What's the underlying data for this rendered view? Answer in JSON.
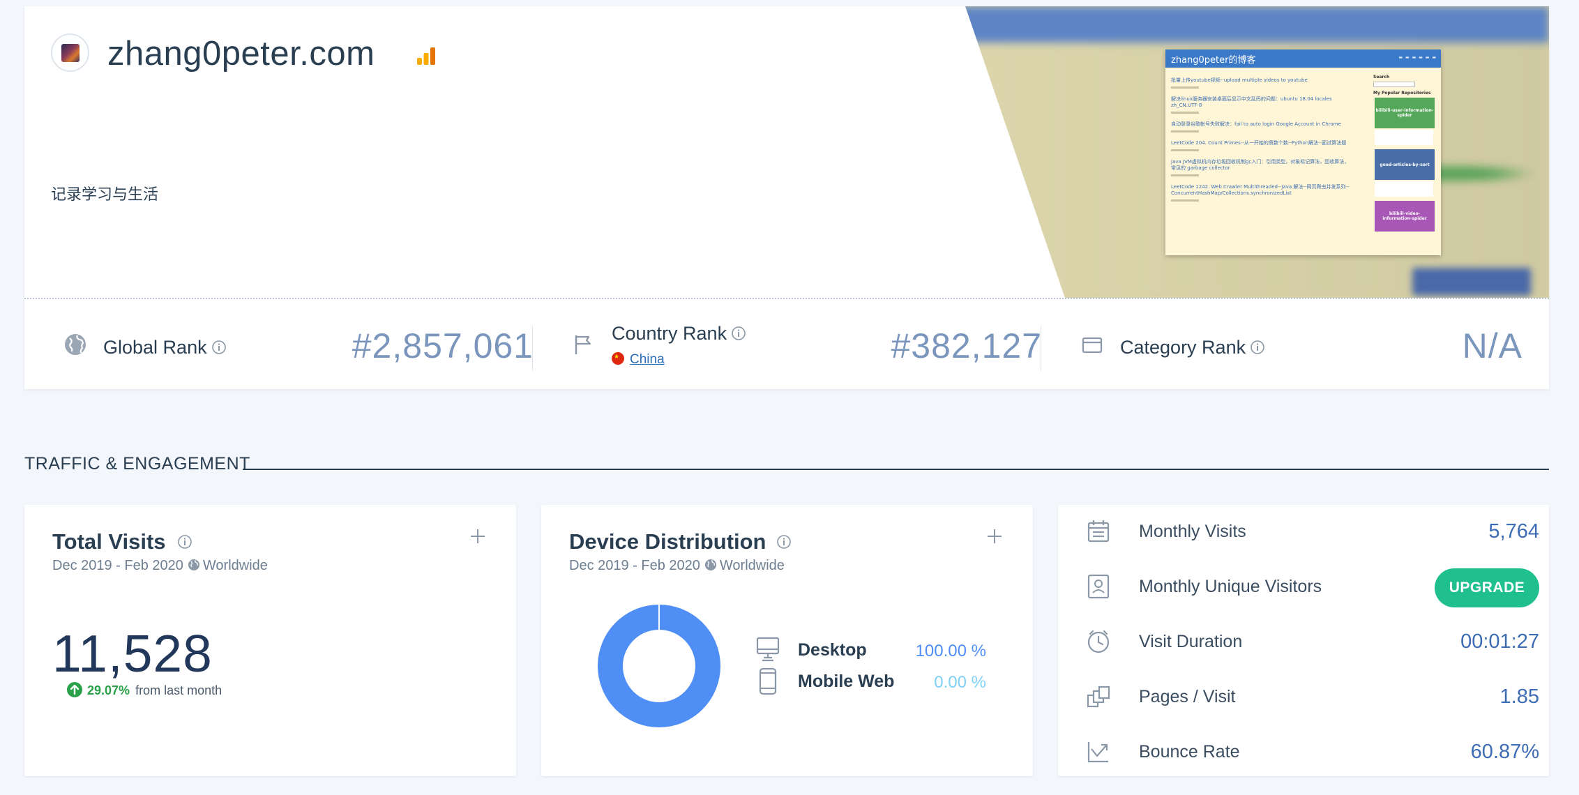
{
  "header": {
    "site_title": "zhang0peter.com",
    "tagline": "记录学习与生活",
    "preview": {
      "blog_title": "zhang0peter的博客",
      "posts": [
        "批量上传youtube视频--upload multiple videos to youtube",
        "解决linux服务器安装桌面后显示中文乱码的问题：ubuntu 18.04 locales zh_CN.UTF-8",
        "自动登录谷歌帐号失败解决：fail to auto login Google Account in Chrome",
        "LeetCode 204. Count Primes--从一开始的质数个数--Python解法--面试算法题",
        "Java JVM虚拟机内存垃圾回收机制gc入门：引用类型，对象标记算法，回收算法，常见的 garbage collector",
        "LeetCode 1242. Web Crawler Multithreaded--Java 解法--网页爬虫并发系列--ConcurrentHashMap/Collections.synchronizedList"
      ],
      "sidebar_search": "Search",
      "sidebar_repos_title": "My Popular Repositories",
      "repos": [
        "bilibili-user-information-spider",
        "good-articles-by-sort",
        "bilibili-video-information-spider"
      ]
    }
  },
  "ranks": {
    "global": {
      "label": "Global Rank",
      "value": "#2,857,061"
    },
    "country": {
      "label": "Country Rank",
      "country": "China",
      "value": "#382,127"
    },
    "category": {
      "label": "Category Rank",
      "value": "N/A"
    }
  },
  "section_title": "TRAFFIC & ENGAGEMENT",
  "total_visits": {
    "title": "Total Visits",
    "period": "Dec 2019 - Feb 2020",
    "region": "Worldwide",
    "value": "11,528",
    "change_pct": "29.07%",
    "change_text": "from last month"
  },
  "device_distribution": {
    "title": "Device Distribution",
    "period": "Dec 2019 - Feb 2020",
    "region": "Worldwide",
    "items": [
      {
        "label": "Desktop",
        "value": "100.00 %",
        "share": 100,
        "icon": "desktop-icon",
        "color": "#4f8ef5"
      },
      {
        "label": "Mobile Web",
        "value": "0.00 %",
        "share": 0,
        "icon": "mobile-icon",
        "color": "#7fd0f5"
      }
    ]
  },
  "metrics": [
    {
      "label": "Monthly Visits",
      "value": "5,764",
      "icon": "calendar-icon"
    },
    {
      "label": "Monthly Unique Visitors",
      "button": "UPGRADE",
      "icon": "id-badge-icon"
    },
    {
      "label": "Visit Duration",
      "value": "00:01:27",
      "icon": "clock-icon"
    },
    {
      "label": "Pages / Visit",
      "value": "1.85",
      "icon": "pages-icon"
    },
    {
      "label": "Bounce Rate",
      "value": "60.87%",
      "icon": "bounce-icon"
    }
  ],
  "colors": {
    "accent_blue": "#3c6cb4",
    "rank_value": "#7a96bd",
    "upgrade_green": "#1fc08e",
    "positive_green": "#2aa148",
    "donut_desktop": "#4f8ef5"
  }
}
